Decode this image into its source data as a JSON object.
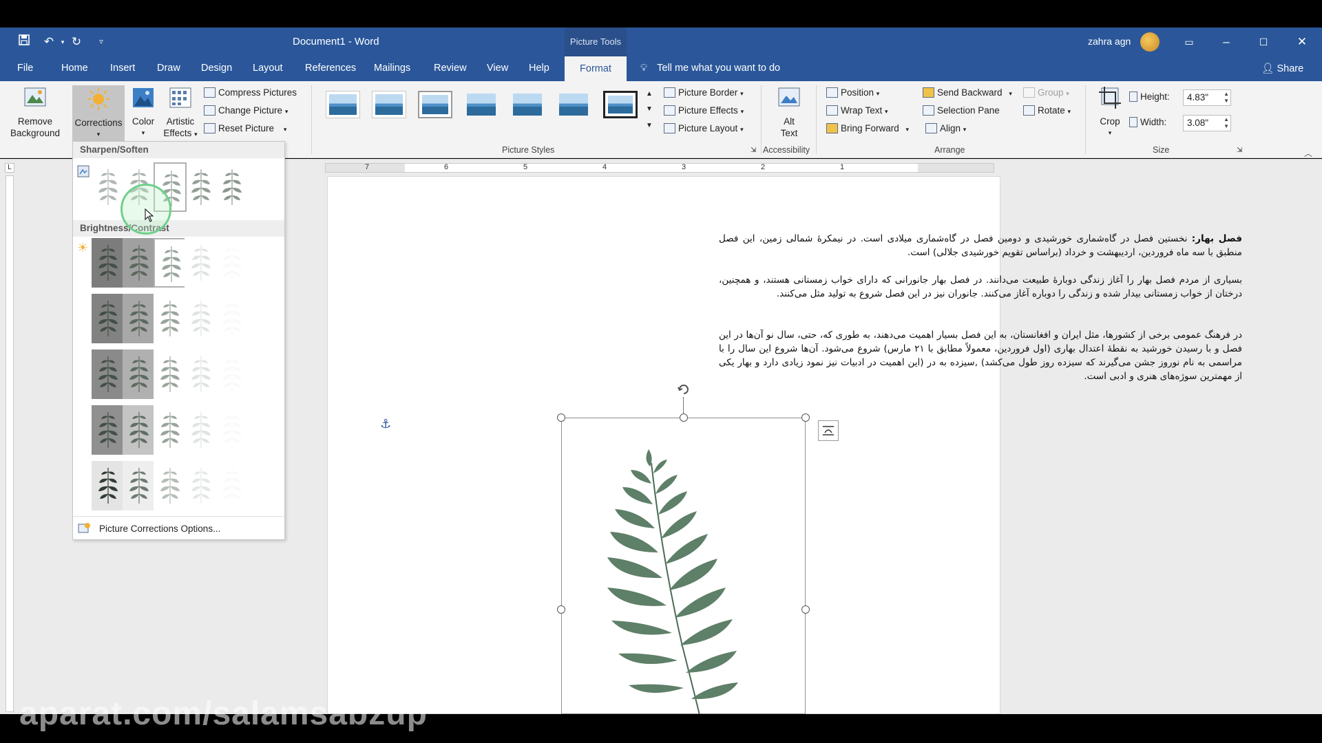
{
  "titlebar": {
    "doc_title": "Document1  -  Word",
    "context_tab": "Picture Tools",
    "user": "zahra agn"
  },
  "tabs": [
    "File",
    "Home",
    "Insert",
    "Draw",
    "Design",
    "Layout",
    "References",
    "Mailings",
    "Review",
    "View",
    "Help"
  ],
  "active_tab": "Format",
  "tellme": "Tell me what you want to do",
  "share": "Share",
  "ribbon": {
    "remove_bg": "Remove Background",
    "corrections": "Corrections",
    "color": "Color",
    "artistic_effects": "Artistic Effects",
    "compress": "Compress Pictures",
    "change": "Change Picture",
    "reset": "Reset Picture",
    "picture_styles_label": "Picture Styles",
    "picture_border": "Picture Border",
    "picture_effects": "Picture Effects",
    "picture_layout": "Picture Layout",
    "alt_text": "Alt Text",
    "accessibility_label": "Accessibility",
    "position": "Position",
    "wrap_text": "Wrap Text",
    "bring_forward": "Bring Forward",
    "send_backward": "Send Backward",
    "selection_pane": "Selection Pane",
    "align": "Align",
    "group": "Group",
    "rotate": "Rotate",
    "arrange_label": "Arrange",
    "crop": "Crop",
    "height_label": "Height:",
    "height_value": "4.83\"",
    "width_label": "Width:",
    "width_value": "3.08\"",
    "size_label": "Size"
  },
  "dropdown": {
    "sharpen_header": "Sharpen/Soften",
    "brightness_header": "Brightness/Contrast",
    "footer": "Picture Corrections Options..."
  },
  "ruler_numbers": [
    "7",
    "6",
    "5",
    "4",
    "3",
    "2",
    "1"
  ],
  "document": {
    "p1_bold": "فصل بهار:",
    "p1": " نخستین فصل در گاه‌شماری خورشیدی و دومین فصل در گاه‌شماری میلادی است. در نیمکرهٔ شمالی زمین، این فصل منطبق با سه ماه فروردین، اردیبهشت و خرداد (براساس تقویم خورشیدی جلالی) است.",
    "p2": "بسیاری از مردم فصل بهار را آغاز زندگی دوبارهٔ طبیعت می‌دانند. در فصل بهار جانورانی که دارای خواب زمستانی هستند، و همچنین، درختان از خواب زمستانی بیدار شده و زندگی را دوباره آغاز می‌کنند. جانوران نیز در این فصل شروع به تولید مثل می‌کنند.",
    "p3": "در فرهنگ عمومی برخی از کشورها، مثل ایران و افغانستان، به این فصل بسیار اهمیت می‌دهند، به طوری که، حتی، سال نو آن‌ها در این فصل و با رسیدن خورشید به نقطهٔ اعتدال بهاری (اول فروردین، معمولاً مطابق با ۲۱ مارس) شروع می‌شود. آن‌ها شروع این سال را با مراسمی به نام نوروز جشن می‌گیرند که سیزده روز طول می‌کشد) ,سیزده به در (این اهمیت در ادبیات نیز نمود زیادی دارد و بهار یکی از مهمترین سوژه‌های هنری و ادبی است."
  },
  "watermark": "aparat.com/salamsabzup",
  "colors": {
    "word_blue": "#2b579a",
    "ribbon_bg": "#f3f3f3",
    "leaf_green": "#4a6b55"
  }
}
